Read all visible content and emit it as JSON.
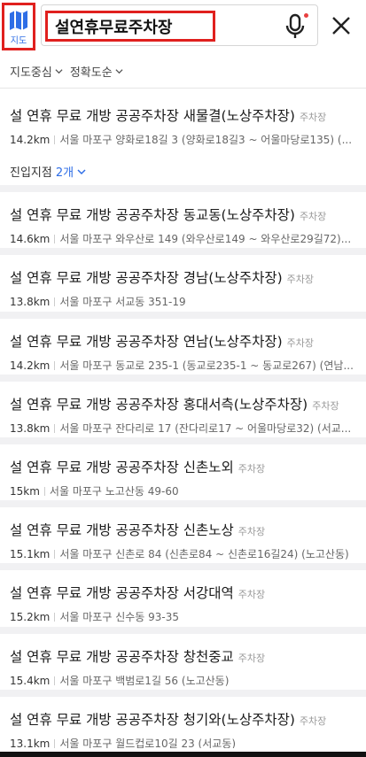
{
  "map_button": {
    "label": "지도",
    "icon": "map-icon"
  },
  "search": {
    "value": "설연휴무료주차장"
  },
  "filters": [
    {
      "label": "지도중심"
    },
    {
      "label": "정확도순"
    }
  ],
  "results": [
    {
      "name": "설 연휴 무료 개방 공공주차장 새물결(노상주차장)",
      "category": "주차장",
      "distance": "14.2km",
      "address": "서울 마포구 양화로18길 3 (양화로18길3 ~ 어울마당로135) (...",
      "entry_label": "진입지점",
      "entry_count": "2개"
    },
    {
      "name": "설 연휴 무료 개방 공공주차장 동교동(노상주차장)",
      "category": "주차장",
      "distance": "14.6km",
      "address": "서울 마포구 와우산로 149 (와우산로149 ~ 와우산로29길72)..."
    },
    {
      "name": "설 연휴 무료 개방 공공주차장 경남(노상주차장)",
      "category": "주차장",
      "distance": "13.8km",
      "address": "서울 마포구 서교동 351-19"
    },
    {
      "name": "설 연휴 무료 개방 공공주차장 연남(노상주차장)",
      "category": "주차장",
      "distance": "14.2km",
      "address": "서울 마포구 동교로 235-1 (동교로235-1 ~ 동교로267) (연남..."
    },
    {
      "name": "설 연휴 무료 개방 공공주차장 홍대서측(노상주차장)",
      "category": "주차장",
      "distance": "13.8km",
      "address": "서울 마포구 잔다리로 17 (잔다리로17 ~ 어울마당로32) (서교..."
    },
    {
      "name": "설 연휴 무료 개방 공공주차장 신촌노외",
      "category": "주차장",
      "distance": "15km",
      "address": "서울 마포구 노고산동 49-60"
    },
    {
      "name": "설 연휴 무료 개방 공공주차장 신촌노상",
      "category": "주차장",
      "distance": "15.1km",
      "address": "서울 마포구 신촌로 84 (신촌로84 ~ 신촌로16길24) (노고산동)"
    },
    {
      "name": "설 연휴 무료 개방 공공주차장 서강대역",
      "category": "주차장",
      "distance": "15.2km",
      "address": "서울 마포구 신수동 93-35"
    },
    {
      "name": "설 연휴 무료 개방 공공주차장 창천중교",
      "category": "주차장",
      "distance": "15.4km",
      "address": "서울 마포구 백범로1길 56 (노고산동)"
    },
    {
      "name": "설 연휴 무료 개방 공공주차장 청기와(노상주차장)",
      "category": "주차장",
      "distance": "13.1km",
      "address": "서울 마포구 월드컵로10길 23 (서교동)"
    }
  ],
  "colors": {
    "accent": "#2f6ee6",
    "highlight": "#e0201e"
  }
}
